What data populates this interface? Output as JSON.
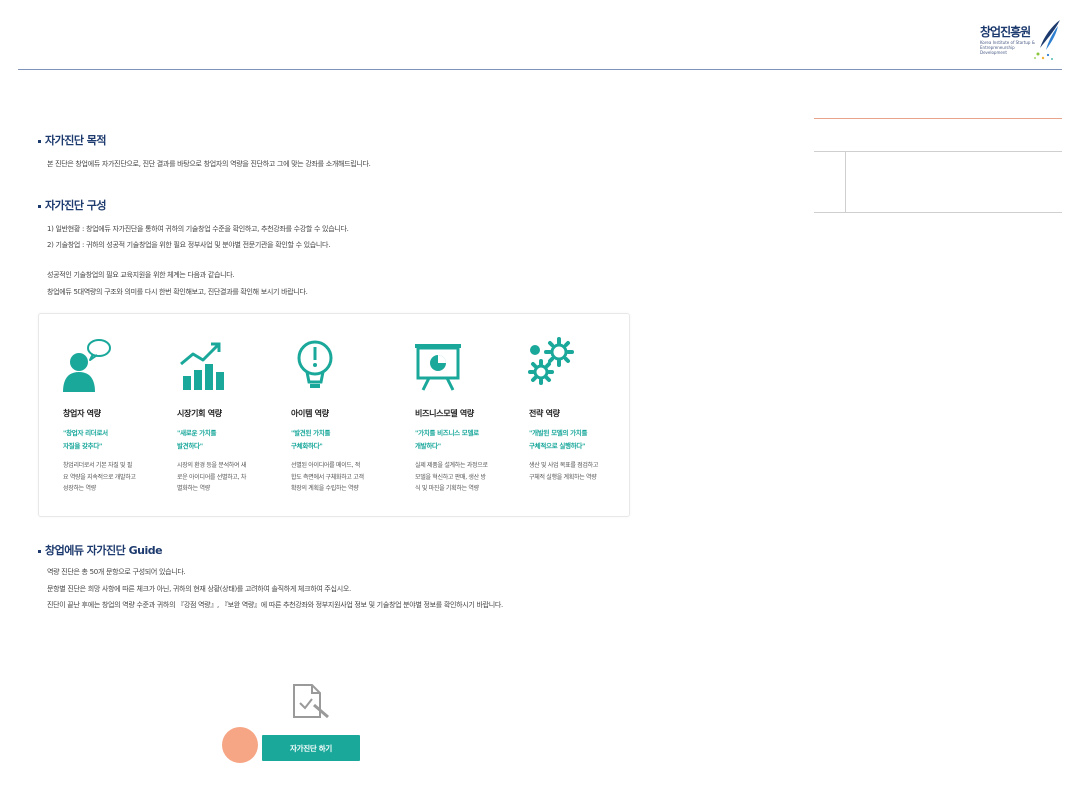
{
  "header": {
    "logo_text": "창업진흥원",
    "logo_sub": "Korea Institute of Startup & Entrepreneurship Development"
  },
  "sections": {
    "purpose": {
      "title": "자가진단 목적",
      "text": "본 진단은 창업에듀 자가진단으로, 진단 결과를 바탕으로 창업자의 역량을 진단하고 그에 맞는 강좌를 소개해드립니다."
    },
    "structure": {
      "title": "자가진단 구성",
      "line1": "1) 일반현황 : 창업에듀 자가진단을 통하여 귀하의 기술창업 수준을 확인하고, 추천강좌를 수강할 수 있습니다.",
      "line2": "2) 기술창업 : 귀하의 성공적 기술창업을 위한 필요 정부사업 및 분야별 전문기관을 확인할 수 있습니다.",
      "line3": "성공적인 기술창업의 필요 교육지원을 위한 체계는 다음과 같습니다.",
      "line4": "창업에듀 5대역량의 구조와 의미를 다시 한번 확인해보고, 진단결과를 확인해 보시기 바랍니다."
    },
    "guide": {
      "title": "창업에듀 자가진단 Guide",
      "line1": "역량 진단은 총 50개 문항으로 구성되어 있습니다.",
      "line2": "문항별 진단은 희망 사항에 따른 체크가 아닌, 귀하의 현재 상황(상태)를 고려하여 솔직하게 체크하여 주십시오.",
      "line3": "진단이 끝난 후에는 창업의 역량 수준과 귀하의 『강점 역량』, 『보완 역량』에 따른 추천강좌와 정부지원사업 정보 및 기술창업 분야별 정보를 확인하시기 바랍니다."
    }
  },
  "competencies": [
    {
      "icon": "entrepreneur-icon",
      "title": "창업자 역량",
      "quote": "\"창업자 리더로서\n자질을 갖추다\"",
      "desc": "창업리더로서 기본 자질 및 필\n요 역량을 지속적으로 개발하고\n성장하는 역량"
    },
    {
      "icon": "market-chart-icon",
      "title": "시장기회 역량",
      "quote": "\"새로운 가치를\n발견하다\"",
      "desc": "시장의 환경 등을 분석하여 새\n로운 아이디어를 선별하고, 차\n별화하는 역량"
    },
    {
      "icon": "idea-bulb-icon",
      "title": "아이템 역량",
      "quote": "\"발견된 가치를\n구체화하다\"",
      "desc": "선별된 아이디어를 메이드, 적\n합도 측면에서 구체화하고 고객\n확장의 계획을 수립하는 역량"
    },
    {
      "icon": "presentation-board-icon",
      "title": "비즈니스모델 역량",
      "quote": "\"가치를 비즈니스 모델로\n개발하다\"",
      "desc": "실제 제품을 설계하는 과정으로\n모델을 혁신하고 판매, 생산 방\n식 및 마진을 기획하는 역량"
    },
    {
      "icon": "strategy-gears-icon",
      "title": "전략 역량",
      "quote": "\"개발된 모델의 가치를\n구체적으로 실행하다\"",
      "desc": "생산 및 사업 목표를 점검하고\n구체적 실행을 계획하는 역량"
    }
  ],
  "action": {
    "button_label": "자가진단 하기",
    "icon": "document-check-icon"
  },
  "colors": {
    "accent": "#1aa89b",
    "title": "#1d3a6e",
    "cursor": "#f5a07e"
  }
}
